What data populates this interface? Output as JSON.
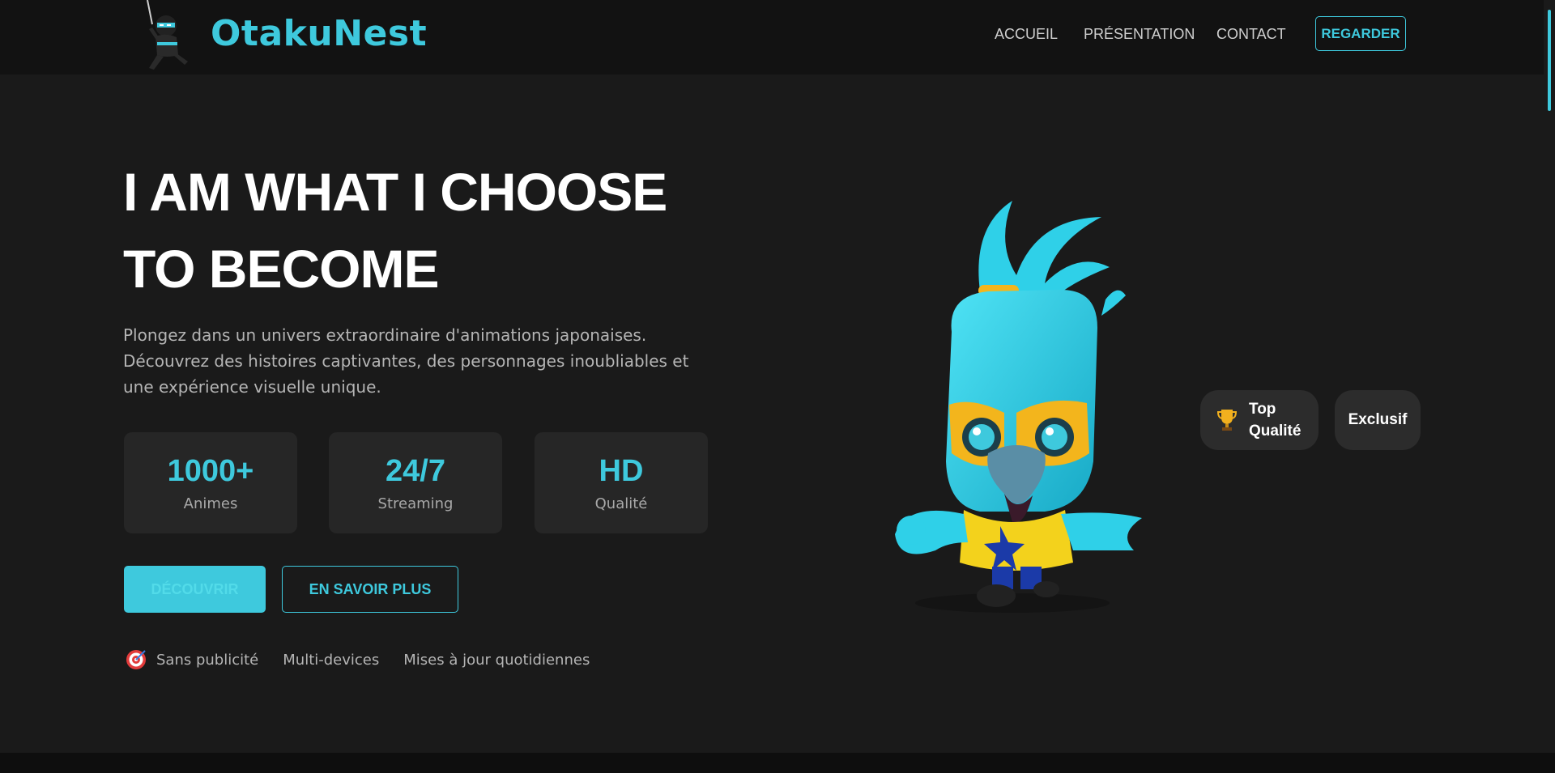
{
  "brand": {
    "name": "OtakuNest",
    "logo_icon": "ninja-mascot-icon",
    "accent": "#3ec9dd"
  },
  "nav": {
    "links": [
      "ACCUEIL",
      "PRÉSENTATION",
      "CONTACT"
    ],
    "cta": "REGARDER"
  },
  "hero": {
    "title_line1": "I AM WHAT I CHOOSE",
    "title_line2": "TO BECOME",
    "description": "Plongez dans un univers extraordinaire d'animations japonaises. Découvrez des histoires captivantes, des personnages inoubliables et une expérience visuelle unique."
  },
  "stats": [
    {
      "value": "1000+",
      "label": "Animes"
    },
    {
      "value": "24/7",
      "label": "Streaming"
    },
    {
      "value": "HD",
      "label": "Qualité"
    }
  ],
  "buttons": {
    "primary": "DÉCOUVRIR",
    "secondary": "EN SAVOIR PLUS"
  },
  "features": {
    "icon": "target-icon",
    "items": [
      "Sans publicité",
      "Multi-devices",
      "Mises à jour quotidiennes"
    ]
  },
  "badges": {
    "top_icon": "trophy-icon",
    "top_line1": "Top",
    "top_line2": "Qualité",
    "exclusive": "Exclusif"
  },
  "mascot": {
    "icon": "parrot-mascot-icon"
  },
  "colors": {
    "background": "#1a1a1a",
    "header": "#121212",
    "card": "#262626",
    "accent": "#3ec9dd"
  }
}
